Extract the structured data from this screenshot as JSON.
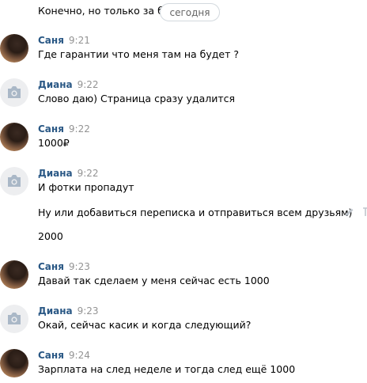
{
  "chat": {
    "partial_message": "Конечно, но только за баб",
    "date_separator": "сегодня",
    "messages": [
      {
        "author": "Саня",
        "time": "9:21",
        "avatar": "photo",
        "lines": [
          "Где гарантии что меня там на будет ?"
        ]
      },
      {
        "author": "Диана",
        "time": "9:22",
        "avatar": "camera-icon",
        "lines": [
          "Слово даю) Страница сразу удалится"
        ]
      },
      {
        "author": "Саня",
        "time": "9:22",
        "avatar": "photo",
        "lines": [
          "1000₽"
        ]
      },
      {
        "author": "Диана",
        "time": "9:22",
        "avatar": "camera-icon",
        "lines": [
          "И фотки пропадут",
          "Ну или добавиться переписка и отправиться всем друзьям)",
          "2000"
        ]
      },
      {
        "author": "Саня",
        "time": "9:23",
        "avatar": "photo",
        "lines": [
          "Давай так сделаем у меня сейчас есть 1000"
        ]
      },
      {
        "author": "Диана",
        "time": "9:23",
        "avatar": "camera-icon",
        "lines": [
          "Окай, сейчас касик и когда следующий?"
        ]
      },
      {
        "author": "Саня",
        "time": "9:24",
        "avatar": "photo",
        "lines": [
          "Зарплата на след неделе и тогда след ещё 1000"
        ]
      }
    ]
  },
  "icons": {
    "edit": "pencil-icon",
    "pin": "pin-icon",
    "camera": "camera-icon"
  },
  "colors": {
    "author": "#2a5885",
    "time": "#939393",
    "camera_bg": "#edeef0",
    "camera_fg": "#aab8c7",
    "pill_border": "#d3d9de"
  }
}
